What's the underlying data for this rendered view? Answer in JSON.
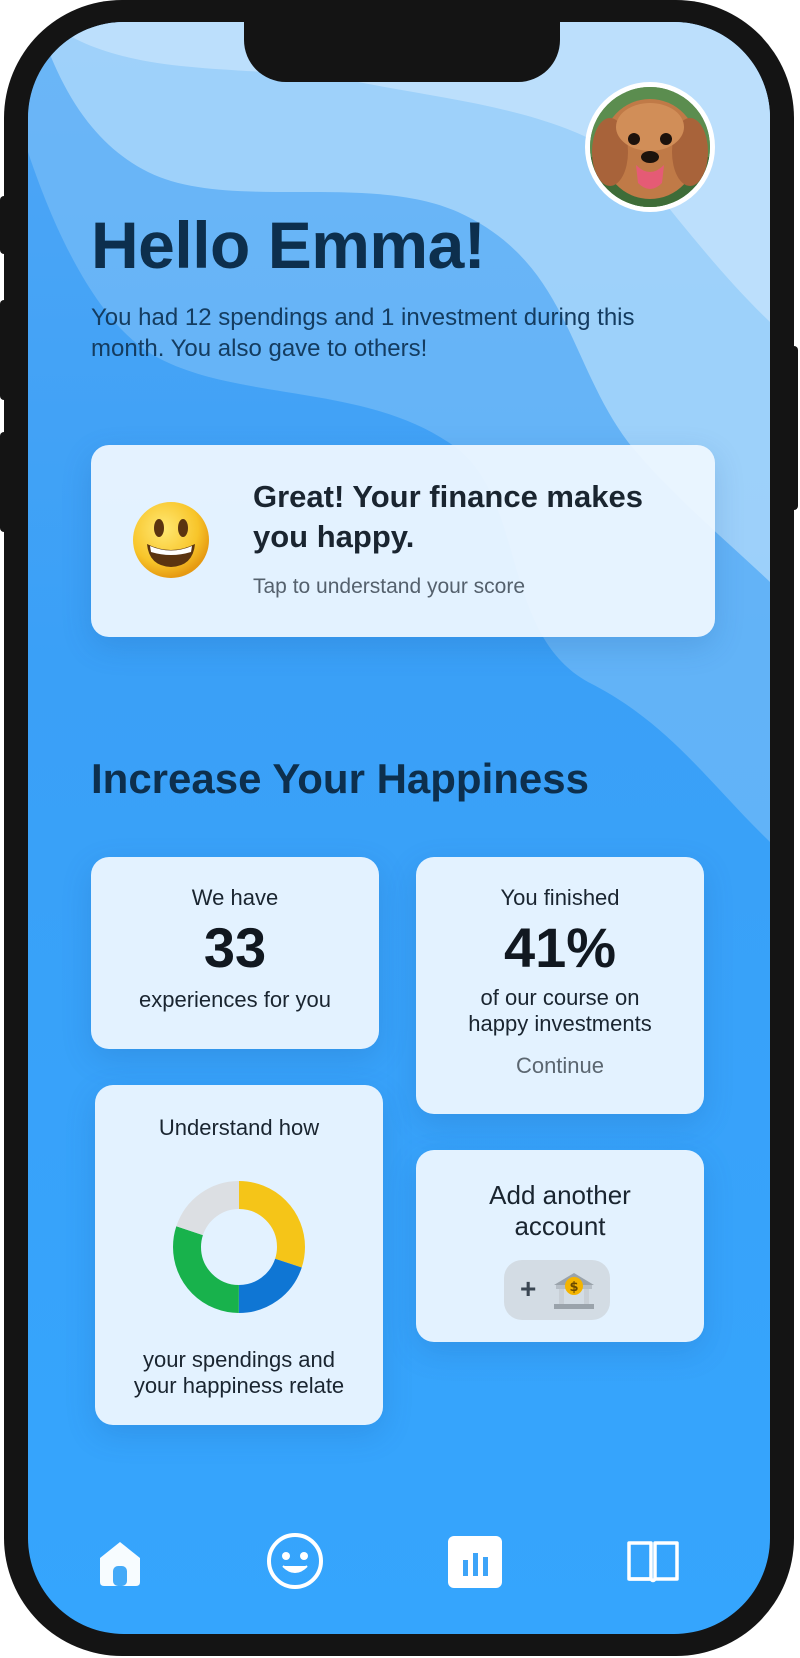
{
  "header": {
    "greeting": "Hello Emma!",
    "summary": "You had 12 spendings and 1 investment during this month. You also gave to others!"
  },
  "score_card": {
    "title": "Great! Your finance makes you happy.",
    "hint": "Tap to understand your score"
  },
  "section": {
    "title": "Increase Your Happiness"
  },
  "experiences_card": {
    "top": "We have",
    "number": "33",
    "bottom": "experiences for you"
  },
  "course_card": {
    "top": "You finished",
    "percent": "41%",
    "line1": "of our course on",
    "line2": "happy investments",
    "action": "Continue"
  },
  "understand_card": {
    "top": "Understand how",
    "line1": "your spendings and",
    "line2": "your happiness relate",
    "donut_segments": [
      {
        "color": "#f5c518",
        "fraction": 0.3
      },
      {
        "color": "#0f76d4",
        "fraction": 0.2
      },
      {
        "color": "#18b24c",
        "fraction": 0.3
      },
      {
        "color": "#dcdfe3",
        "fraction": 0.2
      }
    ]
  },
  "account_card": {
    "line1": "Add another",
    "line2": "account",
    "plus": "+"
  },
  "nav": {
    "items": [
      {
        "icon": "home-icon"
      },
      {
        "icon": "smiley-icon"
      },
      {
        "icon": "bar-chart-icon"
      },
      {
        "icon": "book-icon"
      }
    ]
  },
  "colors": {
    "accent_text": "#0d2f4d",
    "background_blue": "#3aa0f7",
    "card_bg": "#eef7ff"
  }
}
